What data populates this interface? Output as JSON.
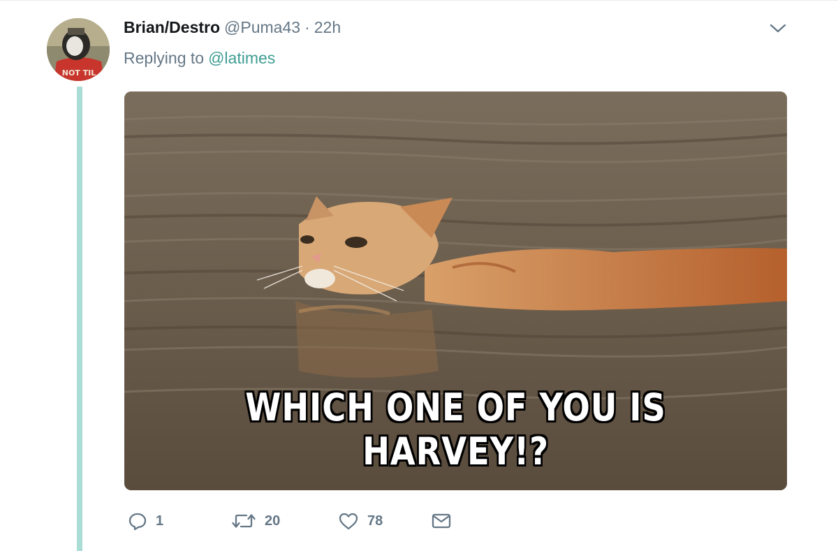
{
  "tweet": {
    "display_name": "Brian/Destro",
    "handle": "@Puma43",
    "separator": "·",
    "time": "22h",
    "reply_prefix": "Replying to",
    "reply_to": "@latimes",
    "image_caption": "WHICH ONE OF YOU IS HARVEY!?",
    "avatar_text": "NOT TIL"
  },
  "actions": {
    "reply_count": "1",
    "retweet_count": "20",
    "like_count": "78"
  },
  "icons": {
    "reply": "reply-icon",
    "retweet": "retweet-icon",
    "like": "heart-icon",
    "message": "envelope-icon",
    "more": "chevron-down-icon"
  },
  "colors": {
    "thread_line": "#a9ddd6",
    "mention": "#3f9d93",
    "secondary_text": "#657786"
  }
}
